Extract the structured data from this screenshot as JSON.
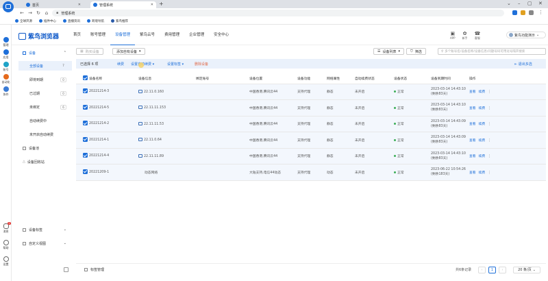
{
  "browser": {
    "tabs": [
      {
        "title": "首页"
      },
      {
        "title": "管理系统"
      }
    ],
    "url": "管理系统",
    "bookmarks": [
      "全球开源",
      "插件中心",
      "直播资讯",
      "跨境导航",
      "紫鸟推荐"
    ]
  },
  "leftbar": {
    "items": [
      "管理",
      "应用",
      "账号",
      "自动化",
      "协作"
    ],
    "bottom": [
      "消息",
      "帮助",
      "设置"
    ],
    "msg_badge": "1"
  },
  "header": {
    "logo": "紫鸟浏览器",
    "nav": [
      "首页",
      "账号管理",
      "设备管理",
      "紫鸟云号",
      "费用管理",
      "企业管理",
      "安全中心"
    ],
    "active_nav": "设备管理",
    "icons": [
      {
        "label": "APP",
        "glyph": "▣"
      },
      {
        "label": "新手",
        "glyph": "✿"
      },
      {
        "label": "客服",
        "glyph": "☎"
      }
    ],
    "user": "紫鸟功能演示"
  },
  "sidebar": {
    "group_label": "设备",
    "items": [
      {
        "label": "全部设备",
        "count": "7"
      },
      {
        "label": "即将到期",
        "count": "0"
      },
      {
        "label": "已过期",
        "count": "0"
      },
      {
        "label": "未绑定",
        "count": "6"
      },
      {
        "label": "自动续费中",
        "count": ""
      },
      {
        "label": "未开启自动续费",
        "count": ""
      }
    ],
    "other": [
      "设备池",
      "设备回收站"
    ],
    "bottom": [
      "设备标签",
      "自定义视图"
    ]
  },
  "toolbar": {
    "buy_label": "购买设备",
    "add_label": "添加自有设备",
    "view_label": "设备列表",
    "filter_label": "筛选",
    "search_placeholder": "多个账号名/设备名称/设备信息/问题号码可用逗号隔开搜索"
  },
  "actionbar": {
    "selected": "已选择 6 项",
    "actions": [
      "续费",
      "设置自动续费",
      "设置标签",
      "删除设备"
    ],
    "exit": "退出多选"
  },
  "table": {
    "headers": [
      "设备名称",
      "设备信息",
      "绑定账号",
      "设备位置",
      "设备功能",
      "网络属性",
      "自动续费状态",
      "设备状态",
      "设备到期时间",
      "操作"
    ],
    "rows": [
      {
        "name": "20221214-3",
        "ip": "22.11.0.160",
        "account": "",
        "location": "中国香港,腾讯云44",
        "func": "支持代理",
        "net": "静态",
        "renew": "未开启",
        "status": "正常",
        "expire": "2023-03-14 14:43:10",
        "remain": "(剩余83天)"
      },
      {
        "name": "20221214-5",
        "ip": "22.11.11.153",
        "account": "",
        "location": "中国香港,腾讯云44",
        "func": "支持代理",
        "net": "静态",
        "renew": "未开启",
        "status": "正常",
        "expire": "2023-03-14 14:43:10",
        "remain": "(剩余83天)"
      },
      {
        "name": "20221214-2",
        "ip": "22.11.11.53",
        "account": "",
        "location": "中国香港,腾讯云44",
        "func": "支持代理",
        "net": "静态",
        "renew": "未开启",
        "status": "正常",
        "expire": "2023-03-14 14:43:09",
        "remain": "(剩余83天)"
      },
      {
        "name": "20221214-1",
        "ip": "22.11.0.64",
        "account": "",
        "location": "中国香港,腾讯云44",
        "func": "支持代理",
        "net": "静态",
        "renew": "未开启",
        "status": "正常",
        "expire": "2023-03-14 14:43:09",
        "remain": "(剩余83天)"
      },
      {
        "name": "20221214-4",
        "ip": "22.11.11.89",
        "account": "",
        "location": "中国香港,腾讯云44",
        "func": "支持代理",
        "net": "静态",
        "renew": "未开启",
        "status": "正常",
        "expire": "2023-03-14 14:43:10",
        "remain": "(剩余83天)"
      },
      {
        "name": "20221209-1",
        "ip": "动态网络",
        "account": "",
        "location": "大陆支持,电信44动态",
        "func": "支持代理",
        "net": "动态",
        "renew": "未开启",
        "status": "正常",
        "expire": "2023-06-22 10:54:26",
        "remain": "(剩余183天)"
      }
    ],
    "row_actions": [
      "查看",
      "续费"
    ]
  },
  "footer": {
    "tag_manage": "标签管理",
    "total": "共6条记录",
    "page": "1",
    "page_size": "20 条/页"
  }
}
